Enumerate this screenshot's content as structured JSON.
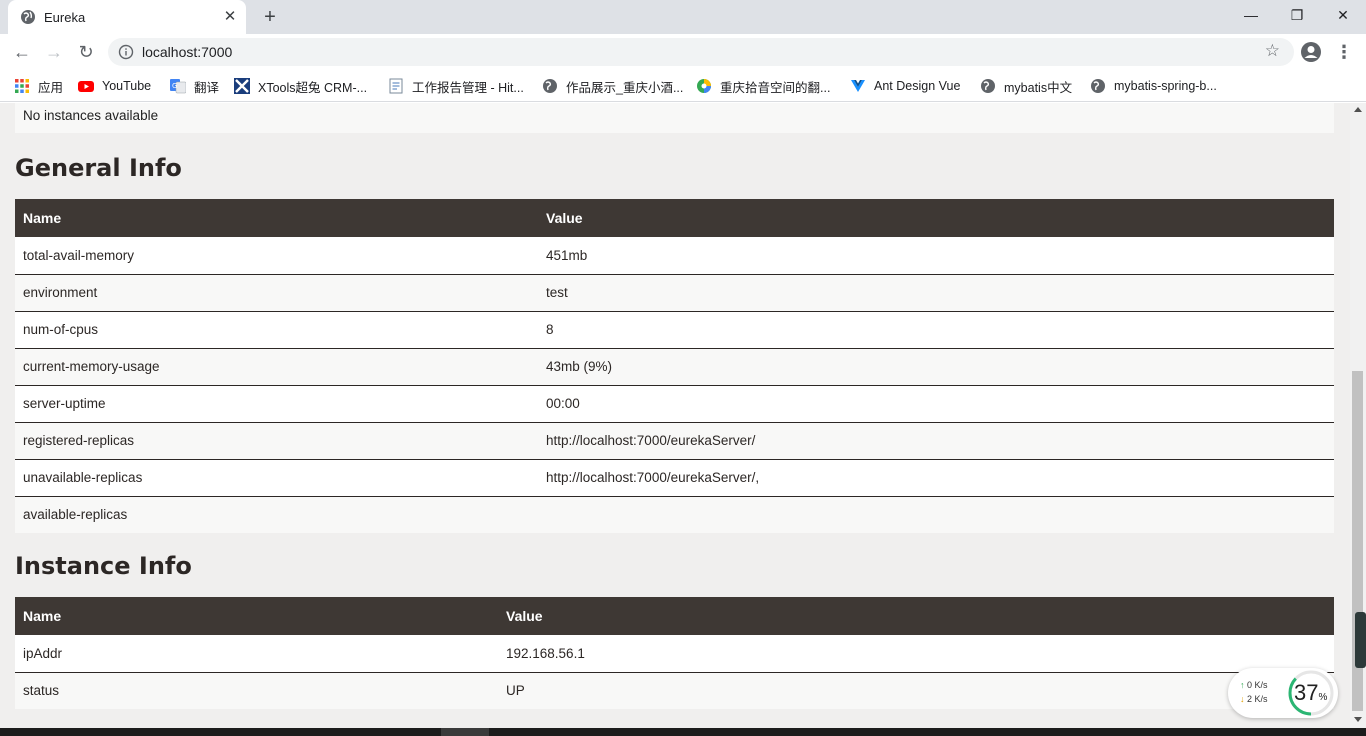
{
  "browser": {
    "tab": {
      "title": "Eureka"
    },
    "omnibox": {
      "url": "localhost:7000"
    },
    "bookmarks": [
      {
        "label": "应用",
        "icon": "apps-grid-icon"
      },
      {
        "label": "YouTube",
        "icon": "youtube-icon"
      },
      {
        "label": "翻译",
        "icon": "translate-icon"
      },
      {
        "label": "XTools超兔 CRM-...",
        "icon": "xtools-icon"
      },
      {
        "label": "工作报告管理 - Hit...",
        "icon": "document-icon"
      },
      {
        "label": "作品展示_重庆小酒...",
        "icon": "globe-icon"
      },
      {
        "label": "重庆拾音空间的翻...",
        "icon": "colorful-logo-icon"
      },
      {
        "label": "Ant Design Vue",
        "icon": "vue-icon"
      },
      {
        "label": "mybatis中文",
        "icon": "globe-icon"
      },
      {
        "label": "mybatis-spring-b...",
        "icon": "globe-icon"
      }
    ]
  },
  "page": {
    "no_instances": "No instances available",
    "general": {
      "title": "General Info",
      "headers": [
        "Name",
        "Value"
      ],
      "rows": [
        {
          "name": "total-avail-memory",
          "value": "451mb"
        },
        {
          "name": "environment",
          "value": "test"
        },
        {
          "name": "num-of-cpus",
          "value": "8"
        },
        {
          "name": "current-memory-usage",
          "value": "43mb (9%)"
        },
        {
          "name": "server-uptime",
          "value": "00:00"
        },
        {
          "name": "registered-replicas",
          "value": "http://localhost:7000/eurekaServer/"
        },
        {
          "name": "unavailable-replicas",
          "value": "http://localhost:7000/eurekaServer/,"
        },
        {
          "name": "available-replicas",
          "value": ""
        }
      ]
    },
    "instance": {
      "title": "Instance Info",
      "headers": [
        "Name",
        "Value"
      ],
      "rows": [
        {
          "name": "ipAddr",
          "value": "192.168.56.1"
        },
        {
          "name": "status",
          "value": "UP"
        }
      ]
    }
  },
  "netmon": {
    "up_value": "0",
    "up_unit": "K/s",
    "down_value": "2",
    "down_unit": "K/s",
    "percent": "37",
    "percent_sign": "%",
    "percent_fraction": 0.37
  }
}
